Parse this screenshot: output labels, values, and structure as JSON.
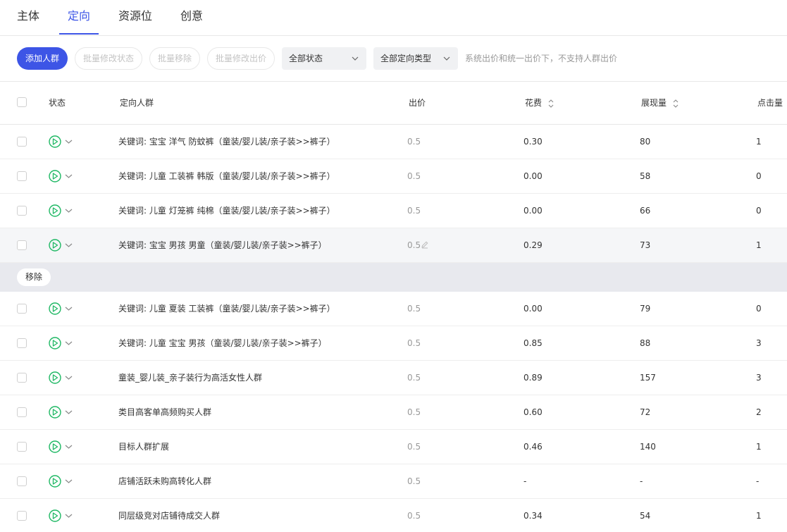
{
  "tabs": [
    {
      "label": "主体",
      "active": false
    },
    {
      "label": "定向",
      "active": true
    },
    {
      "label": "资源位",
      "active": false
    },
    {
      "label": "创意",
      "active": false
    }
  ],
  "toolbar": {
    "add_button": "添加人群",
    "batch_status": "批量修改状态",
    "batch_remove": "批量移除",
    "batch_bid": "批量修改出价",
    "status_select": "全部状态",
    "type_select": "全部定向类型",
    "hint": "系统出价和统一出价下，不支持人群出价"
  },
  "table": {
    "headers": {
      "status": "状态",
      "audience": "定向人群",
      "bid": "出价",
      "cost": "花费",
      "impressions": "展现量",
      "clicks": "点击量"
    },
    "action_bar": {
      "remove_label": "移除"
    },
    "rows": [
      {
        "name": "关键词: 宝宝 洋气 防蚊裤（童装/婴儿装/亲子装>>裤子）",
        "bid": "0.5",
        "cost": "0.30",
        "impressions": "80",
        "clicks": "1"
      },
      {
        "name": "关键词: 儿童 工装裤 韩版（童装/婴儿装/亲子装>>裤子）",
        "bid": "0.5",
        "cost": "0.00",
        "impressions": "58",
        "clicks": "0"
      },
      {
        "name": "关键词: 儿童 灯笼裤 纯棉（童装/婴儿装/亲子装>>裤子）",
        "bid": "0.5",
        "cost": "0.00",
        "impressions": "66",
        "clicks": "0"
      },
      {
        "name": "关键词: 宝宝 男孩 男童（童装/婴儿装/亲子装>>裤子）",
        "bid": "0.5",
        "cost": "0.29",
        "impressions": "73",
        "clicks": "1"
      },
      {
        "name": "关键词: 儿童 夏装 工装裤（童装/婴儿装/亲子装>>裤子）",
        "bid": "0.5",
        "cost": "0.00",
        "impressions": "79",
        "clicks": "0"
      },
      {
        "name": "关键词: 儿童 宝宝 男孩（童装/婴儿装/亲子装>>裤子）",
        "bid": "0.5",
        "cost": "0.85",
        "impressions": "88",
        "clicks": "3"
      },
      {
        "name": "童装_婴儿装_亲子装行为高活女性人群",
        "bid": "0.5",
        "cost": "0.89",
        "impressions": "157",
        "clicks": "3"
      },
      {
        "name": "类目高客单高频购买人群",
        "bid": "0.5",
        "cost": "0.60",
        "impressions": "72",
        "clicks": "2"
      },
      {
        "name": "目标人群扩展",
        "bid": "0.5",
        "cost": "0.46",
        "impressions": "140",
        "clicks": "1"
      },
      {
        "name": "店铺活跃未购高转化人群",
        "bid": "0.5",
        "cost": "-",
        "impressions": "-",
        "clicks": "-"
      },
      {
        "name": "同层级竞对店铺待成交人群",
        "bid": "0.5",
        "cost": "0.34",
        "impressions": "54",
        "clicks": "1"
      }
    ]
  },
  "colors": {
    "accent": "#3d55e6",
    "status_green": "#1fb864",
    "muted": "#999999",
    "action_bar": "#e8e9ee"
  }
}
